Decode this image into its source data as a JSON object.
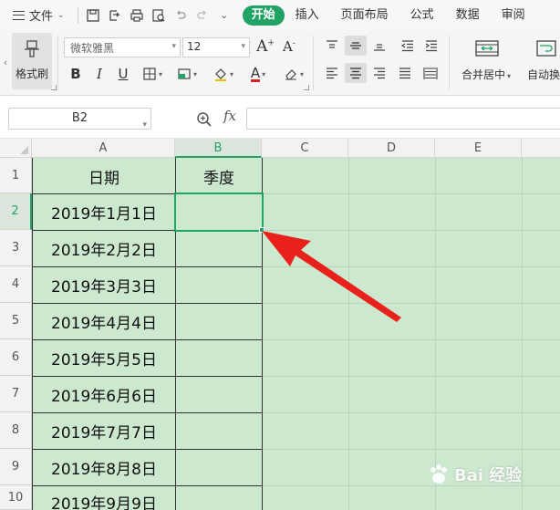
{
  "menubar": {
    "file_label": "文件",
    "tabs": [
      {
        "label": "开始",
        "active": true
      },
      {
        "label": "插入",
        "active": false
      },
      {
        "label": "页面布局",
        "active": false
      },
      {
        "label": "公式",
        "active": false
      },
      {
        "label": "数据",
        "active": false
      },
      {
        "label": "审阅",
        "active": false
      }
    ],
    "accent_color": "#21a366"
  },
  "ribbon": {
    "format_painter_label": "格式刷",
    "font_name": "微软雅黑",
    "font_size": "12",
    "merge_label": "合并居中",
    "autowrap_label": "自动换"
  },
  "formula_bar": {
    "name_box": "B2",
    "fx_label": "fx",
    "formula": ""
  },
  "sheet": {
    "columns": [
      "A",
      "B",
      "C",
      "D",
      "E"
    ],
    "rows": [
      "1",
      "2",
      "3",
      "4",
      "5",
      "6",
      "7",
      "8",
      "9",
      "10"
    ],
    "selected_column": "B",
    "selected_row": "2",
    "header_row": {
      "A": "日期",
      "B": "季度"
    },
    "dates": [
      "2019年1月1日",
      "2019年2月2日",
      "2019年3月3日",
      "2019年4月4日",
      "2019年5月5日",
      "2019年6月6日",
      "2019年7月7日",
      "2019年8月8日",
      "2019年9月9日"
    ],
    "cell_bg": "#cce8cf"
  },
  "annotation": {
    "arrow_color": "#e8221b"
  },
  "watermark": {
    "text": "Bai 经验"
  }
}
